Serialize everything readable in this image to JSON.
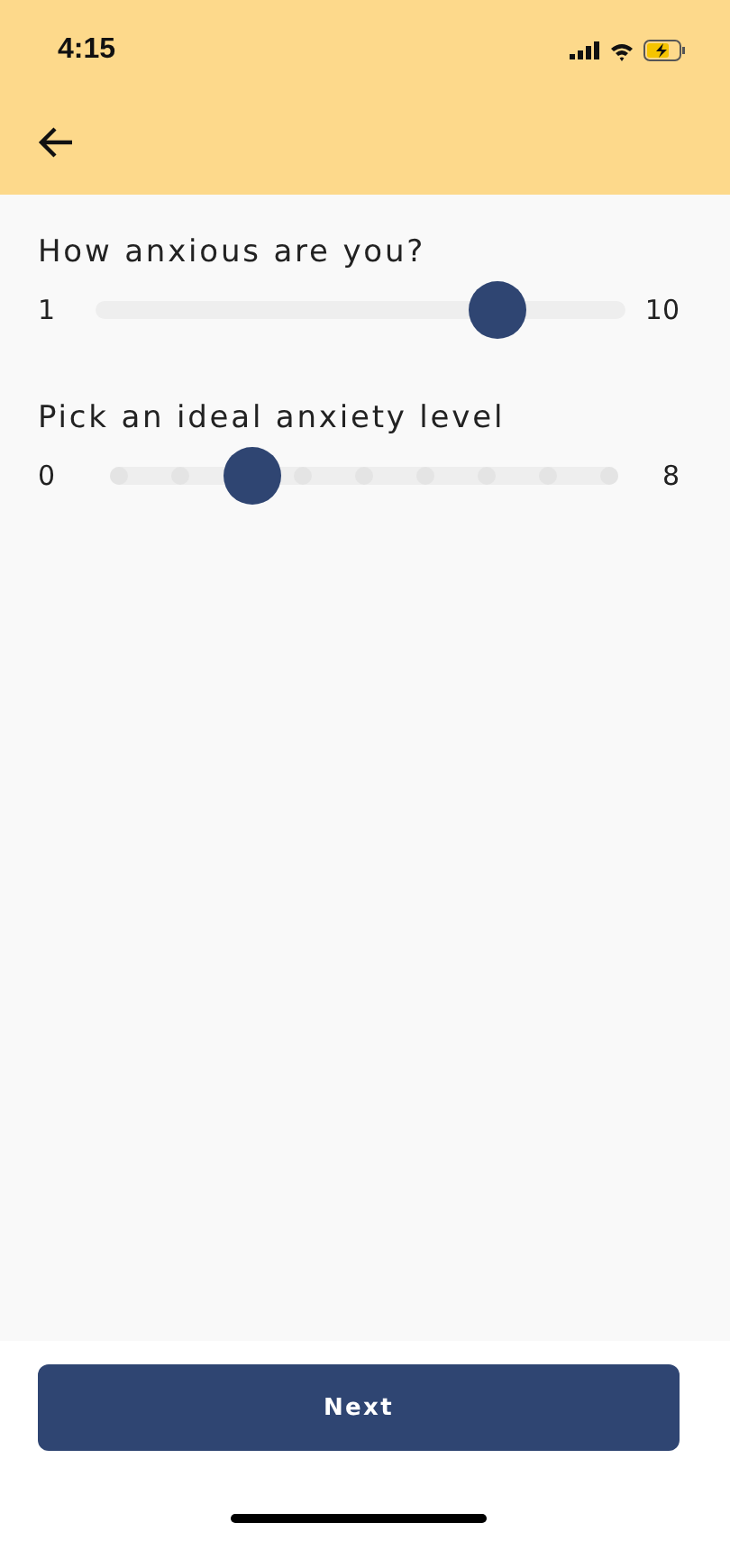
{
  "status_bar": {
    "time": "4:15"
  },
  "questions": [
    {
      "kind": "continuous",
      "label": "How anxious are you?",
      "min_label": "1",
      "max_label": "10",
      "level": 0.79
    },
    {
      "kind": "stepped",
      "label": "Pick an ideal anxiety level",
      "min_label": "0",
      "max_label": "8",
      "level": 0.25
    }
  ],
  "next_button": "Next"
}
